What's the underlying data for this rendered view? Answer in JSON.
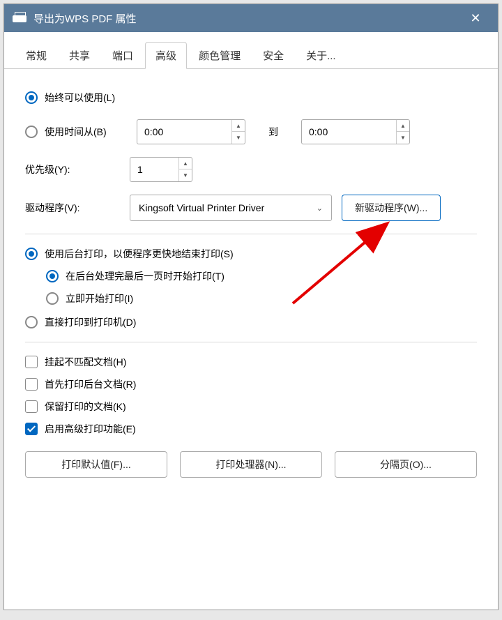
{
  "titlebar": {
    "title": "导出为WPS PDF 属性",
    "close": "✕"
  },
  "tabs": {
    "items": [
      {
        "label": "常规"
      },
      {
        "label": "共享"
      },
      {
        "label": "端口"
      },
      {
        "label": "高级"
      },
      {
        "label": "颜色管理"
      },
      {
        "label": "安全"
      },
      {
        "label": "关于..."
      }
    ]
  },
  "availability": {
    "always": "始终可以使用(L)",
    "schedule": "使用时间从(B)",
    "from": "0:00",
    "to_label": "到",
    "to": "0:00"
  },
  "priority": {
    "label": "优先级(Y):",
    "value": "1"
  },
  "driver": {
    "label": "驱动程序(V):",
    "selected": "Kingsoft Virtual Printer Driver",
    "new_btn": "新驱动程序(W)..."
  },
  "spool": {
    "use_spool": "使用后台打印，以便程序更快地结束打印(S)",
    "after_last": "在后台处理完最后一页时开始打印(T)",
    "immediate": "立即开始打印(I)",
    "direct": "直接打印到打印机(D)"
  },
  "options": {
    "hold": "挂起不匹配文档(H)",
    "spooled_first": "首先打印后台文档(R)",
    "keep": "保留打印的文档(K)",
    "advanced": "启用高级打印功能(E)"
  },
  "buttons": {
    "defaults": "打印默认值(F)...",
    "processor": "打印处理器(N)...",
    "separator": "分隔页(O)..."
  }
}
